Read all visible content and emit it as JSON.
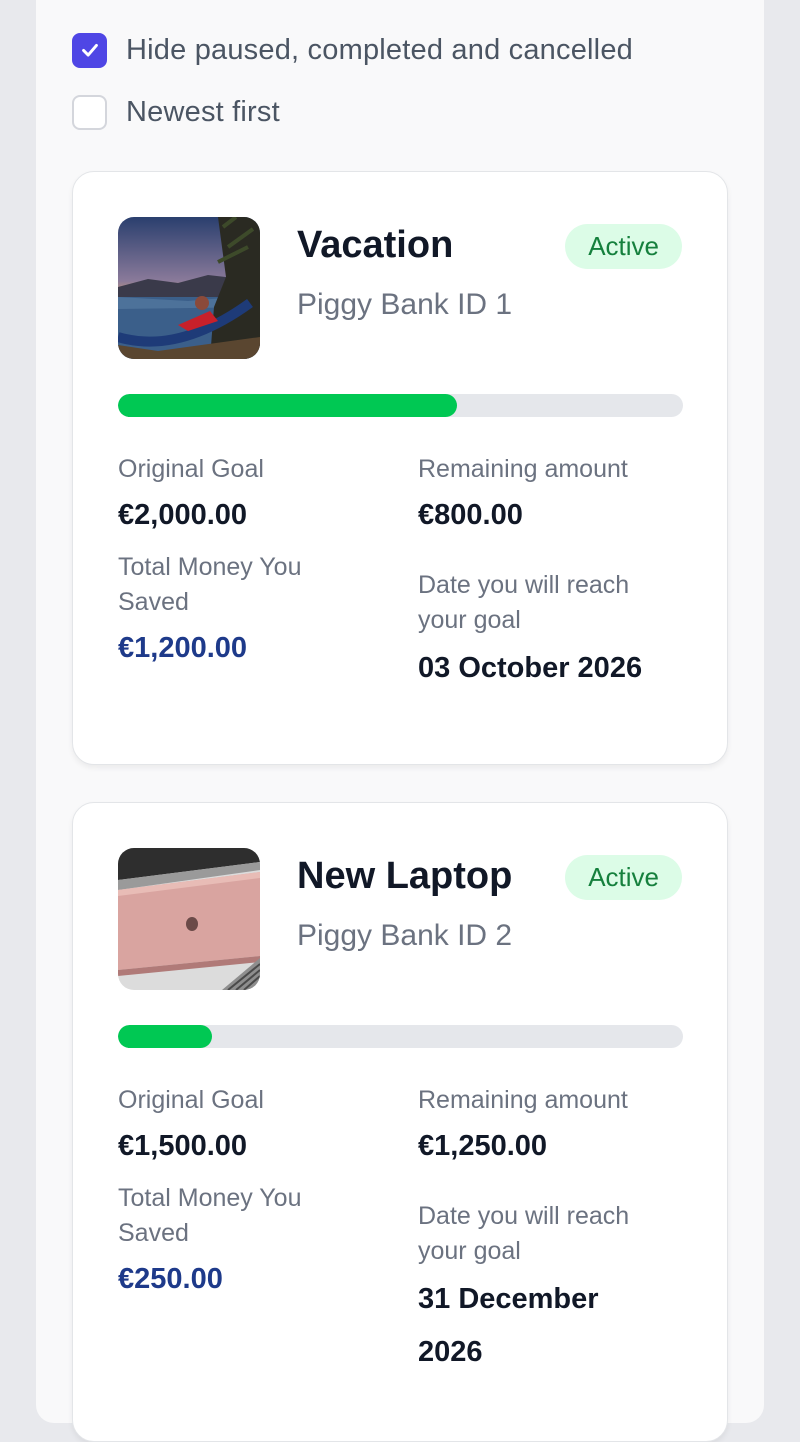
{
  "filters": [
    {
      "label": "Hide paused, completed and cancelled",
      "checked": true
    },
    {
      "label": "Newest first",
      "checked": false
    }
  ],
  "colors": {
    "accent": "#4f46e5",
    "progress": "#00c853",
    "badge_bg": "#dcfce7",
    "badge_text": "#15803d",
    "saved_value": "#1e3a8a"
  },
  "cards": [
    {
      "title": "Vacation",
      "subtitle": "Piggy Bank ID 1",
      "status": "Active",
      "image": "hammock-lake-photo",
      "progress": 0.6,
      "original_goal_label": "Original Goal",
      "original_goal": "€2,000.00",
      "remaining_label": "Remaining amount",
      "remaining": "€800.00",
      "saved_label": "Total Money You Saved",
      "saved": "€1,200.00",
      "date_label": "Date you will reach your goal",
      "date": "03 October 2026"
    },
    {
      "title": "New Laptop",
      "subtitle": "Piggy Bank ID 2",
      "status": "Active",
      "image": "laptop-photo",
      "progress": 0.167,
      "original_goal_label": "Original Goal",
      "original_goal": "€1,500.00",
      "remaining_label": "Remaining amount",
      "remaining": "€1,250.00",
      "saved_label": "Total Money You Saved",
      "saved": "€250.00",
      "date_label": "Date you will reach your goal",
      "date": "31 December 2026"
    }
  ]
}
